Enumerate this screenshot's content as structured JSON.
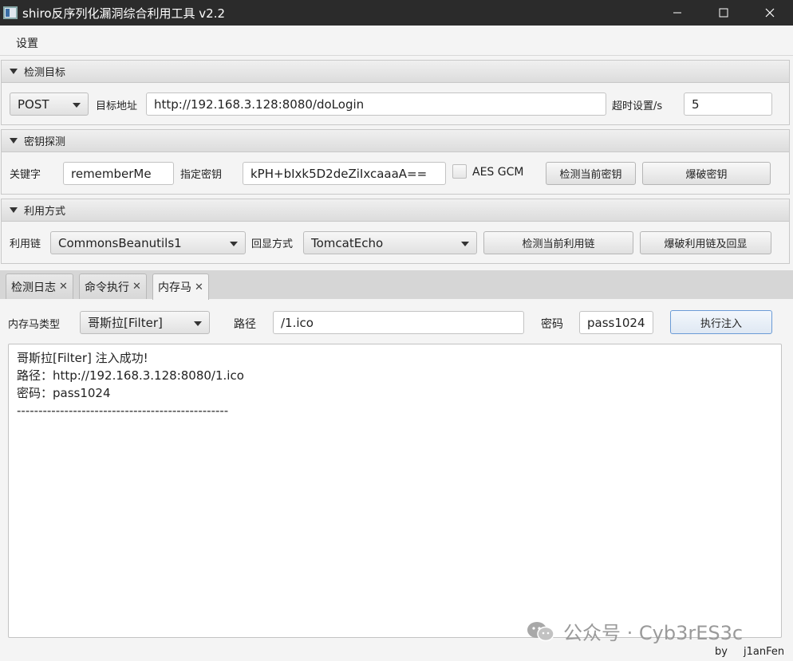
{
  "window": {
    "title": "shiro反序列化漏洞综合利用工具 v2.2",
    "minimize": "—",
    "maximize": "☐",
    "close": "✕"
  },
  "menu": {
    "settings": "设置"
  },
  "target_section": {
    "title": "检测目标",
    "method": "POST",
    "url_label": "目标地址",
    "url_value": "http://192.168.3.128:8080/doLogin",
    "timeout_label": "超时设置/s",
    "timeout_value": "5"
  },
  "key_section": {
    "title": "密钥探测",
    "keyword_label": "关键字",
    "keyword_value": "rememberMe",
    "key_label": "指定密钥",
    "key_value": "kPH+bIxk5D2deZiIxcaaaA==",
    "aes_gcm_label": "AES GCM",
    "check_key_button": "检测当前密钥",
    "brute_key_button": "爆破密钥"
  },
  "exploit_section": {
    "title": "利用方式",
    "chain_label": "利用链",
    "chain_value": "CommonsBeanutils1",
    "echo_label": "回显方式",
    "echo_value": "TomcatEcho",
    "check_chain_button": "检测当前利用链",
    "brute_chain_button": "爆破利用链及回显"
  },
  "tabs": [
    {
      "label": "检测日志",
      "close": "✕"
    },
    {
      "label": "命令执行",
      "close": "✕"
    },
    {
      "label": "内存马",
      "close": "✕"
    }
  ],
  "memshell": {
    "type_label": "内存马类型",
    "type_value": "哥斯拉[Filter]",
    "path_label": "路径",
    "path_value": "/1.ico",
    "password_label": "密码",
    "password_value": "pass1024",
    "inject_button": "执行注入",
    "output_lines": [
      "哥斯拉[Filter]  注入成功!",
      "路径：http://192.168.3.128:8080/1.ico",
      "密码：pass1024",
      "-------------------------------------------------"
    ]
  },
  "watermark": {
    "text": "公众号 · Cyb3rES3c"
  },
  "footer": {
    "by": "by",
    "author": "j1anFen"
  },
  "colors": {
    "titlebar": "#2b2b2b",
    "accent_border": "#6b9bd6"
  }
}
